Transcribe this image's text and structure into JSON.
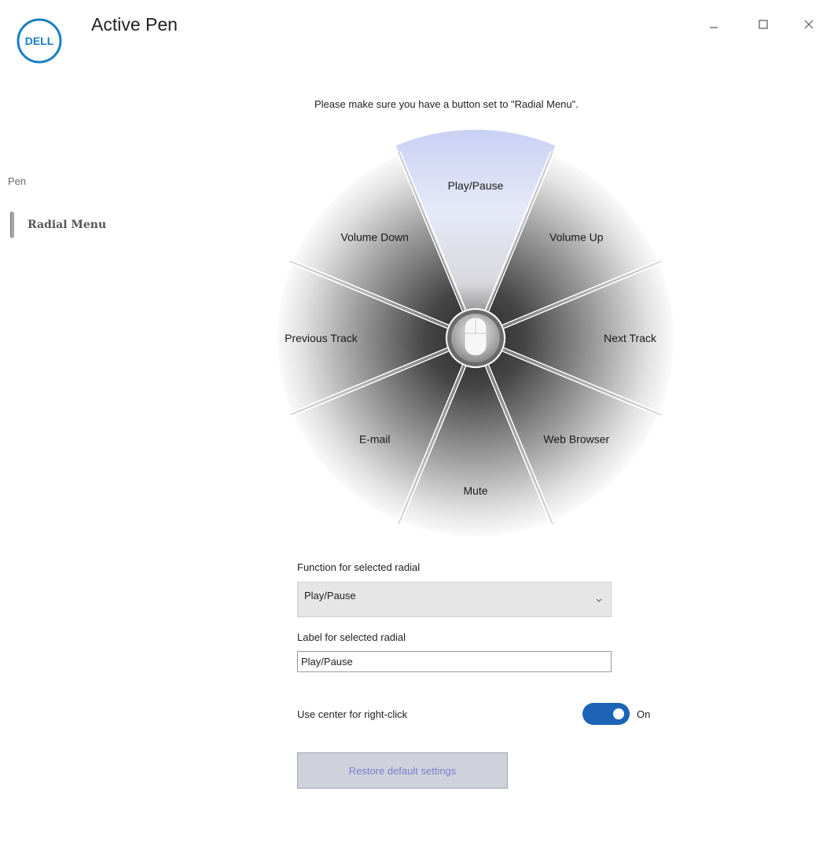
{
  "window": {
    "title": "Active Pen",
    "logo_text": "DELL",
    "controls": {
      "minimize": "—",
      "maximize": "☐",
      "close": "✕"
    }
  },
  "sidebar": {
    "section_label": "Pen",
    "items": [
      {
        "label": "Radial Menu",
        "selected": true
      }
    ]
  },
  "main": {
    "hint": "Please make sure you have a button set to \"Radial Menu\".",
    "radial": {
      "selected": "Play/Pause",
      "segments": [
        "Play/Pause",
        "Volume Up",
        "Next Track",
        "Web Browser",
        "Mute",
        "E-mail",
        "Previous Track",
        "Volume Down"
      ],
      "center_icon": "pen-mouse-icon"
    },
    "function_field": {
      "label": "Function for selected radial",
      "value": "Play/Pause"
    },
    "label_field": {
      "label": "Label for selected radial",
      "value": "Play/Pause"
    },
    "toggle": {
      "label": "Use center for right-click",
      "state": "On",
      "on": true
    },
    "restore_button": "Restore default settings"
  },
  "colors": {
    "toggle_on": "#1d63b6",
    "selected_segment": "#cfd6f4",
    "restore_text": "#7a7fd0"
  }
}
